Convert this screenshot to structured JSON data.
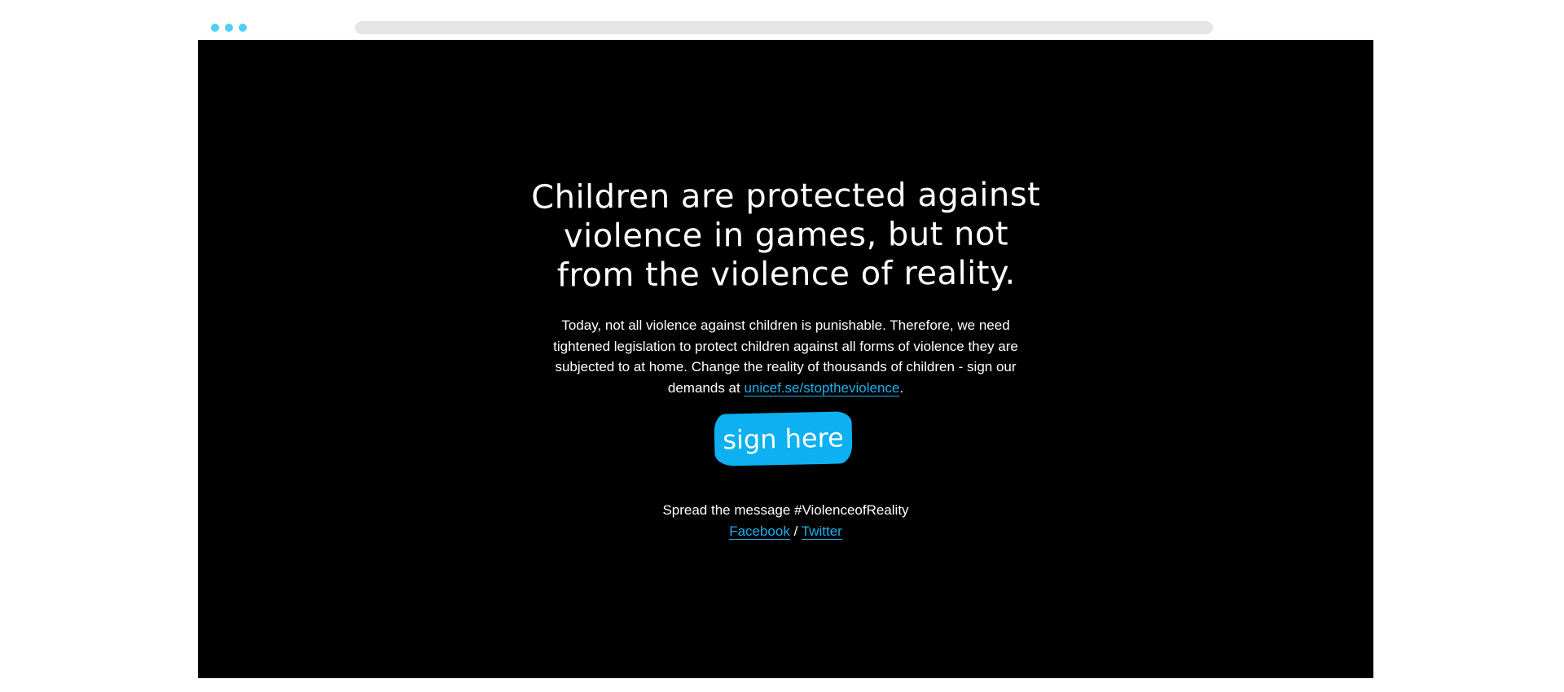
{
  "page": {
    "headline": "Children are protected against violence in games, but not from the violence of reality.",
    "body_before_link": "Today, not all violence against children is punishable. Therefore, we need tightened legislation to protect children against all forms of violence they are subjected to at home. Change the reality of thousands of children - sign our demands at ",
    "body_link": "unicef.se/stoptheviolence",
    "body_after_link": ".",
    "sign_button": "sign here",
    "spread_message": "Spread the message #ViolenceofReality",
    "facebook": "Facebook",
    "separator": "/",
    "twitter": "Twitter"
  },
  "colors": {
    "accent": "#1ab0ef",
    "background": "#000000",
    "text": "#ffffff",
    "window_dots": "#4fd0f2",
    "address_bar": "#e6e6e6"
  }
}
